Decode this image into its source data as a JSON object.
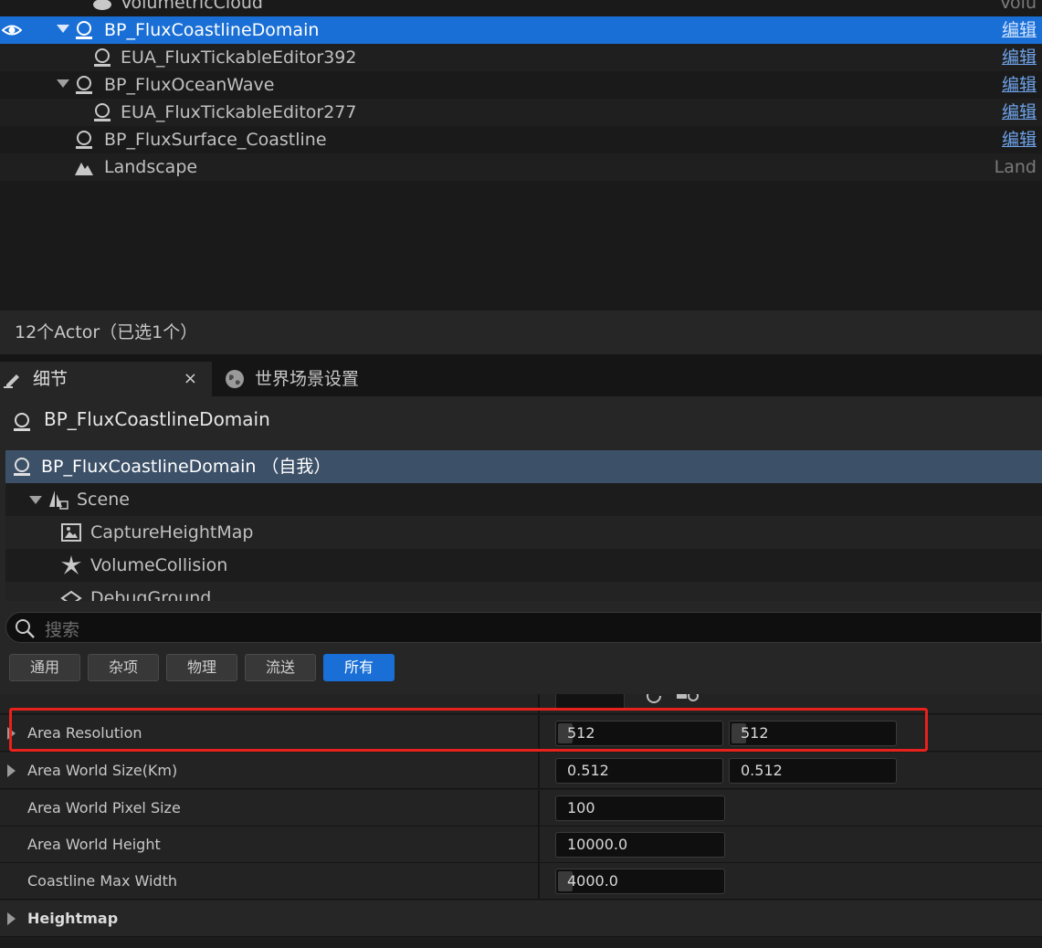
{
  "outliner": {
    "rows": [
      {
        "name": "VolumetricCloud",
        "type": "Volu"
      },
      {
        "name": "BP_FluxCoastlineDomain",
        "type": "编辑"
      },
      {
        "name": "EUA_FluxTickableEditor392",
        "type": "编辑"
      },
      {
        "name": "BP_FluxOceanWave",
        "type": "编辑"
      },
      {
        "name": "EUA_FluxTickableEditor277",
        "type": "编辑"
      },
      {
        "name": "BP_FluxSurface_Coastline",
        "type": "编辑"
      },
      {
        "name": "Landscape",
        "type": "Land"
      }
    ],
    "status": "12个Actor（已选1个）"
  },
  "tabs": {
    "details": "细节",
    "close": "×",
    "world_settings": "世界场景设置"
  },
  "details": {
    "actor_name": "BP_FluxCoastlineDomain",
    "components": [
      {
        "name": "BP_FluxCoastlineDomain （自我）"
      },
      {
        "name": "Scene"
      },
      {
        "name": "CaptureHeightMap"
      },
      {
        "name": "VolumeCollision"
      },
      {
        "name": "DebugGround"
      }
    ]
  },
  "search": {
    "placeholder": "搜索"
  },
  "filters": [
    "通用",
    "杂项",
    "物理",
    "流送",
    "所有"
  ],
  "properties": {
    "area_resolution": {
      "label": "Area Resolution",
      "x": "512",
      "y": "512"
    },
    "area_world_size": {
      "label": "Area World Size(Km)",
      "x": "0.512",
      "y": "0.512"
    },
    "area_world_pixel_size": {
      "label": "Area World Pixel Size",
      "value": "100"
    },
    "area_world_height": {
      "label": "Area World Height",
      "value": "10000.0"
    },
    "coastline_max_width": {
      "label": "Coastline Max Width",
      "value": "4000.0"
    },
    "heightmap": {
      "label": "Heightmap"
    }
  },
  "colors": {
    "selection": "#1a6fd6",
    "highlight_box": "#e8211c"
  }
}
